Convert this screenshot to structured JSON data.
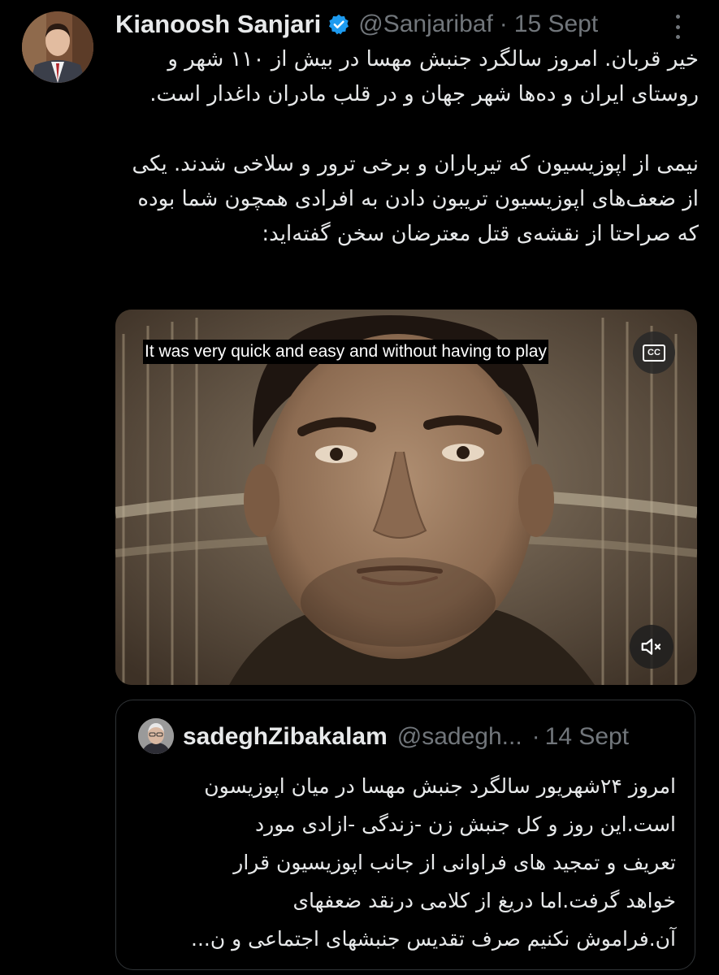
{
  "tweet": {
    "author": {
      "display_name": "Kianoosh Sanjari",
      "handle": "@Sanjaribaf",
      "verified_icon": "verified-badge-icon"
    },
    "separator": "·",
    "date": "15 Sept",
    "more_icon": "more-options-icon",
    "paragraphs": [
      "خیر قربان. امروز سالگرد جنبش مهسا در بیش از ۱۱۰ شهر و روستای ایران و ده‌ها شهر جهان و در قلب مادران داغدار است.",
      "نیمی از اپوزیسیون که تیرباران و برخی ترور و سلاخی شدند. یکی از ضعف‌های اپوزیسیون تریبون دادن به افرادی همچون شما بوده که صراحتا از نقشه‌ی قتل معترضان سخن گفته‌اید:"
    ],
    "media": {
      "caption": "It was very quick and easy and without having to play",
      "cc_label": "CC",
      "mute_icon": "muted-speaker-icon"
    }
  },
  "quoted_tweet": {
    "display_name": "sadeghZibakalam",
    "handle": "@sadegh...",
    "separator": "·",
    "date": "14 Sept",
    "lines": [
      "امروز ۲۴شهریور سالگرد جنبش مهسا در میان اپوزیسون",
      "است.این روز و کل جنبش زن -زندگی -ازادی مورد",
      "تعریف و تمجید های فراوانی از جانب اپوزیسیون قرار",
      "خواهد گرفت.اما دریغ از کلامی درنقد ضعفهای",
      "آن.فراموش نکنیم صرف تقدیس جنبشهای اجتماعی و ن..."
    ]
  },
  "colors": {
    "background": "#000000",
    "primary_text": "#e7e9ea",
    "secondary_text": "#71767b",
    "verified_blue": "#1d9bf0",
    "border": "#2f3336"
  }
}
